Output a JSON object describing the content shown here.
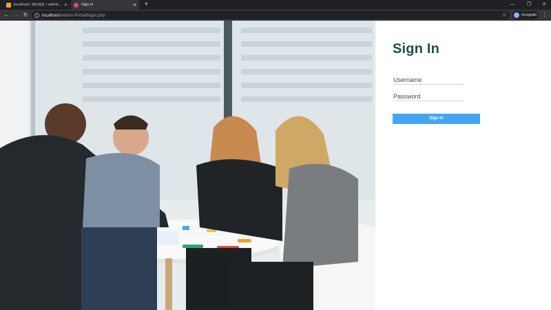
{
  "browser": {
    "tabs": [
      {
        "title": "localhost / MySQL / admin / users",
        "favicon_color": "#f0a040",
        "active": false
      },
      {
        "title": "Sign In",
        "favicon_color": "#e83e8c",
        "active": true
      }
    ],
    "new_tab_icon": "plus-icon",
    "url_host": "localhost",
    "url_path": "/Admin-Portal/login.php",
    "incognito_label": "Incognito"
  },
  "login": {
    "title": "Sign In",
    "username_placeholder": "Username",
    "password_placeholder": "Password",
    "button_label": "Sign In",
    "accent_color": "#44a6f3",
    "title_color": "#1f4e4f"
  },
  "hero_image": {
    "subject": "team-meeting-photo"
  }
}
